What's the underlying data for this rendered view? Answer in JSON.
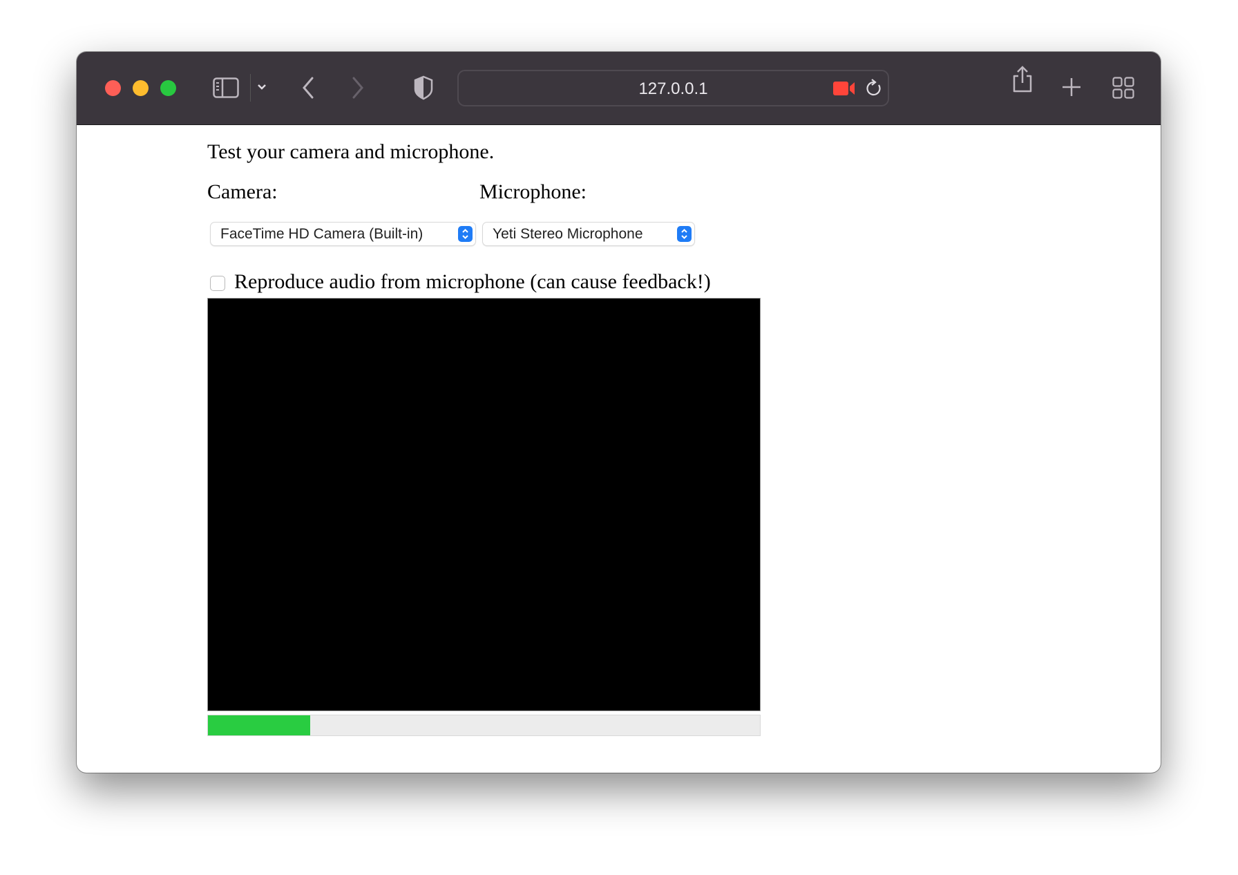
{
  "browser": {
    "url": "127.0.0.1",
    "icons": [
      "sidebar-icon",
      "chevron-down-icon",
      "back-icon",
      "forward-icon",
      "privacy-shield-icon",
      "camera-recording-icon",
      "reload-icon",
      "share-icon",
      "new-tab-icon",
      "tab-overview-icon"
    ],
    "colors": {
      "close": "#fe5f57",
      "minimize": "#febc2e",
      "maximize": "#28c840",
      "recording": "#ff453a"
    }
  },
  "page": {
    "heading": "Test your camera and microphone.",
    "camera_label": "Camera:",
    "camera_selected": "FaceTime HD Camera (Built-in)",
    "microphone_label": "Microphone:",
    "microphone_selected": "Yeti Stereo Microphone",
    "reproduce_audio_label": "Reproduce audio from microphone (can cause feedback!)",
    "reproduce_audio_checked": false,
    "audio_level_percent": 18.5,
    "audio_level_color": "#29cc41"
  }
}
